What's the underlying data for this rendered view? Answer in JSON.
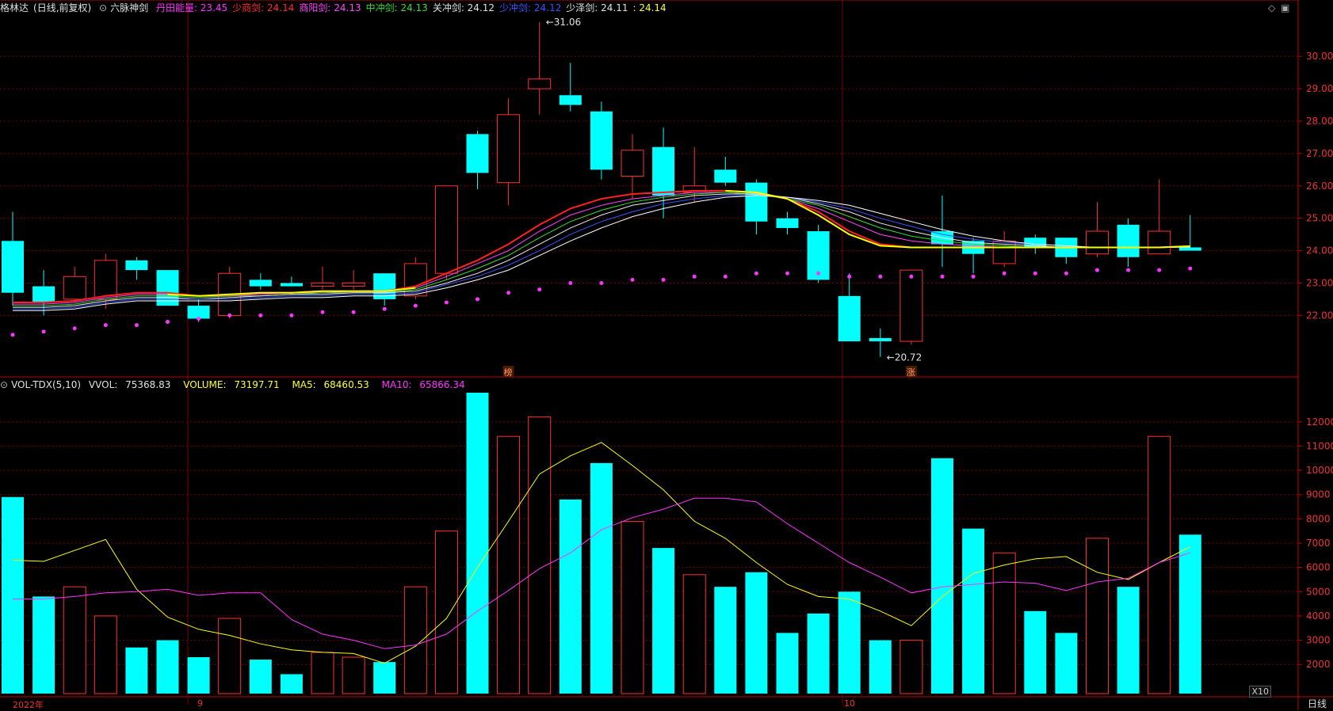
{
  "header": {
    "stock_name": "格林达",
    "mode": "(日线,前复权)",
    "indicator_name": "六脉神剑",
    "lines": [
      {
        "label": "丹田能量:",
        "value": "23.45",
        "color": "#ff33ff"
      },
      {
        "label": "少商剑:",
        "value": "24.14",
        "color": "#ff2a2a"
      },
      {
        "label": "商阳剑:",
        "value": "24.13",
        "color": "#ff44ff"
      },
      {
        "label": "中冲剑:",
        "value": "24.13",
        "color": "#33dd33"
      },
      {
        "label": "关冲剑:",
        "value": "24.12",
        "color": "#e0e0e0"
      },
      {
        "label": "少冲剑:",
        "value": "24.12",
        "color": "#3355ff"
      },
      {
        "label": "少泽剑:",
        "value": "24.11",
        "color": "#e0e0e0"
      },
      {
        "label": ":",
        "value": "24.14",
        "color": "#ffff33"
      }
    ]
  },
  "volume_header": {
    "name": "VOL-TDX(5,10)",
    "vvol_label": "VVOL:",
    "vvol": "75368.83",
    "volume_label": "VOLUME:",
    "volume": "73197.71",
    "ma5_label": "MA5:",
    "ma5": "68460.53",
    "ma10_label": "MA10:",
    "ma10": "65866.34",
    "colors": {
      "vvol": "#e0e0e0",
      "volume": "#ffff33",
      "ma5": "#ffff33",
      "ma10": "#ff33ff"
    }
  },
  "x_axis_labels": {
    "year": "2022年",
    "month_9": "9",
    "month_10": "10"
  },
  "period_label": "日线",
  "scale_label": "X10",
  "colors": {
    "up": "#ff3030",
    "down": "#00ffff",
    "grid": "#7a0000",
    "axis": "#c00000",
    "ma_red": "#ff2020",
    "ma_yellow": "#ffff00",
    "dots": "#ff33ff"
  },
  "chart_data": [
    {
      "type": "candlestick",
      "title": "六脉神剑",
      "ylim": [
        20.2,
        31.3
      ],
      "y_ticks": [
        "22.00",
        "23.00",
        "24.00",
        "25.00",
        "26.00",
        "27.00",
        "28.00",
        "29.00",
        "30.00"
      ],
      "annotations": [
        {
          "text": "31.06",
          "candle": 17,
          "value": 31.06
        },
        {
          "text": "20.72",
          "candle": 28,
          "value": 20.72
        }
      ],
      "markers": [
        {
          "text": "榜",
          "candle": 16
        },
        {
          "text": "涨",
          "candle": 29
        }
      ],
      "candles": [
        {
          "o": 24.3,
          "h": 25.2,
          "l": 22.3,
          "c": 22.7
        },
        {
          "o": 22.9,
          "h": 23.4,
          "l": 22.0,
          "c": 22.4
        },
        {
          "o": 22.5,
          "h": 23.5,
          "l": 22.4,
          "c": 23.2
        },
        {
          "o": 22.5,
          "h": 23.9,
          "l": 22.2,
          "c": 23.7
        },
        {
          "o": 23.7,
          "h": 23.8,
          "l": 23.1,
          "c": 23.4
        },
        {
          "o": 23.4,
          "h": 23.4,
          "l": 22.3,
          "c": 22.3
        },
        {
          "o": 22.3,
          "h": 22.5,
          "l": 21.8,
          "c": 21.9
        },
        {
          "o": 22.0,
          "h": 23.5,
          "l": 21.9,
          "c": 23.3
        },
        {
          "o": 23.1,
          "h": 23.3,
          "l": 22.8,
          "c": 22.9
        },
        {
          "o": 23.0,
          "h": 23.2,
          "l": 22.9,
          "c": 22.9
        },
        {
          "o": 22.9,
          "h": 23.5,
          "l": 22.8,
          "c": 23.0
        },
        {
          "o": 22.9,
          "h": 23.4,
          "l": 22.8,
          "c": 23.0
        },
        {
          "o": 23.3,
          "h": 23.3,
          "l": 22.3,
          "c": 22.5
        },
        {
          "o": 22.6,
          "h": 23.8,
          "l": 22.5,
          "c": 23.6
        },
        {
          "o": 23.3,
          "h": 26.0,
          "l": 23.1,
          "c": 26.0
        },
        {
          "o": 27.6,
          "h": 27.7,
          "l": 25.9,
          "c": 26.4
        },
        {
          "o": 26.1,
          "h": 28.7,
          "l": 25.4,
          "c": 28.2
        },
        {
          "o": 29.0,
          "h": 31.06,
          "l": 28.2,
          "c": 29.3
        },
        {
          "o": 28.8,
          "h": 29.8,
          "l": 28.3,
          "c": 28.5
        },
        {
          "o": 28.3,
          "h": 28.6,
          "l": 26.2,
          "c": 26.5
        },
        {
          "o": 26.3,
          "h": 27.6,
          "l": 25.6,
          "c": 27.1
        },
        {
          "o": 27.2,
          "h": 27.8,
          "l": 25.0,
          "c": 25.7
        },
        {
          "o": 25.8,
          "h": 27.2,
          "l": 25.5,
          "c": 26.0
        },
        {
          "o": 26.5,
          "h": 26.9,
          "l": 26.0,
          "c": 26.1
        },
        {
          "o": 26.1,
          "h": 26.2,
          "l": 24.5,
          "c": 24.9
        },
        {
          "o": 25.0,
          "h": 25.2,
          "l": 24.5,
          "c": 24.7
        },
        {
          "o": 24.6,
          "h": 24.8,
          "l": 23.0,
          "c": 23.1
        },
        {
          "o": 22.6,
          "h": 23.3,
          "l": 21.2,
          "c": 21.2
        },
        {
          "o": 21.3,
          "h": 21.6,
          "l": 20.72,
          "c": 21.2
        },
        {
          "o": 21.2,
          "h": 23.4,
          "l": 21.1,
          "c": 23.4
        },
        {
          "o": 24.6,
          "h": 25.7,
          "l": 23.5,
          "c": 24.2
        },
        {
          "o": 24.3,
          "h": 24.4,
          "l": 23.3,
          "c": 23.9
        },
        {
          "o": 23.6,
          "h": 24.6,
          "l": 23.5,
          "c": 24.3
        },
        {
          "o": 24.4,
          "h": 24.5,
          "l": 23.9,
          "c": 24.1
        },
        {
          "o": 24.4,
          "h": 24.4,
          "l": 23.6,
          "c": 23.8
        },
        {
          "o": 23.9,
          "h": 25.5,
          "l": 23.8,
          "c": 24.6
        },
        {
          "o": 24.8,
          "h": 25.0,
          "l": 23.5,
          "c": 23.8
        },
        {
          "o": 23.9,
          "h": 26.2,
          "l": 23.9,
          "c": 24.6
        },
        {
          "o": 24.1,
          "h": 25.1,
          "l": 24.0,
          "c": 24.0
        }
      ],
      "series": [
        {
          "name": "丹田能量",
          "style": "dots",
          "values": [
            21.4,
            21.5,
            21.6,
            21.7,
            21.7,
            21.8,
            21.9,
            22.0,
            22.0,
            22.0,
            22.1,
            22.1,
            22.2,
            22.3,
            22.4,
            22.5,
            22.7,
            22.8,
            23.0,
            23.0,
            23.1,
            23.1,
            23.2,
            23.2,
            23.3,
            23.3,
            23.3,
            23.2,
            23.2,
            23.2,
            23.2,
            23.2,
            23.3,
            23.3,
            23.3,
            23.4,
            23.4,
            23.4,
            23.45
          ]
        },
        {
          "name": "少商剑",
          "values": [
            22.4,
            22.4,
            22.45,
            22.6,
            22.7,
            22.7,
            22.6,
            22.6,
            22.7,
            22.7,
            22.75,
            22.75,
            22.75,
            22.9,
            23.3,
            23.7,
            24.2,
            24.8,
            25.3,
            25.6,
            25.75,
            25.8,
            25.85,
            25.85,
            25.8,
            25.6,
            25.2,
            24.6,
            24.2,
            24.1,
            24.1,
            24.1,
            24.1,
            24.1,
            24.1,
            24.1,
            24.1,
            24.1,
            24.14
          ]
        },
        {
          "name": "商阳剑",
          "values": [
            22.35,
            22.35,
            22.4,
            22.55,
            22.65,
            22.65,
            22.6,
            22.6,
            22.65,
            22.7,
            22.7,
            22.75,
            22.75,
            22.85,
            23.2,
            23.6,
            24.0,
            24.6,
            25.1,
            25.4,
            25.6,
            25.7,
            25.8,
            25.8,
            25.75,
            25.6,
            25.3,
            24.9,
            24.5,
            24.3,
            24.2,
            24.15,
            24.1,
            24.1,
            24.1,
            24.1,
            24.1,
            24.1,
            24.13
          ]
        },
        {
          "name": "中冲剑",
          "values": [
            22.3,
            22.3,
            22.35,
            22.5,
            22.6,
            22.6,
            22.55,
            22.6,
            22.6,
            22.65,
            22.7,
            22.7,
            22.7,
            22.8,
            23.1,
            23.45,
            23.85,
            24.4,
            24.9,
            25.25,
            25.5,
            25.65,
            25.75,
            25.8,
            25.75,
            25.6,
            25.4,
            25.05,
            24.7,
            24.45,
            24.3,
            24.2,
            24.15,
            24.1,
            24.1,
            24.1,
            24.1,
            24.1,
            24.13
          ]
        },
        {
          "name": "关冲剑",
          "values": [
            22.25,
            22.25,
            22.3,
            22.45,
            22.55,
            22.55,
            22.5,
            22.55,
            22.6,
            22.65,
            22.65,
            22.7,
            22.7,
            22.75,
            23.0,
            23.3,
            23.7,
            24.2,
            24.7,
            25.1,
            25.4,
            25.55,
            25.7,
            25.75,
            25.75,
            25.65,
            25.45,
            25.2,
            24.85,
            24.6,
            24.4,
            24.25,
            24.2,
            24.15,
            24.1,
            24.1,
            24.1,
            24.1,
            24.12
          ]
        },
        {
          "name": "少冲剑",
          "values": [
            22.2,
            22.2,
            22.25,
            22.4,
            22.5,
            22.5,
            22.5,
            22.5,
            22.55,
            22.6,
            22.6,
            22.65,
            22.65,
            22.7,
            22.95,
            23.2,
            23.55,
            24.0,
            24.5,
            24.9,
            25.2,
            25.45,
            25.6,
            25.7,
            25.7,
            25.65,
            25.5,
            25.3,
            25.0,
            24.75,
            24.5,
            24.35,
            24.25,
            24.2,
            24.15,
            24.1,
            24.1,
            24.1,
            24.12
          ]
        },
        {
          "name": "少泽剑",
          "values": [
            22.15,
            22.15,
            22.2,
            22.35,
            22.45,
            22.45,
            22.45,
            22.45,
            22.5,
            22.55,
            22.55,
            22.6,
            22.6,
            22.65,
            22.85,
            23.1,
            23.4,
            23.85,
            24.3,
            24.7,
            25.05,
            25.3,
            25.5,
            25.65,
            25.7,
            25.65,
            25.55,
            25.4,
            25.15,
            24.9,
            24.65,
            24.45,
            24.3,
            24.2,
            24.15,
            24.1,
            24.1,
            24.1,
            24.11
          ]
        },
        {
          "name": "",
          "color": "yellow",
          "values": [
            null,
            null,
            null,
            null,
            null,
            22.65,
            22.6,
            22.65,
            22.7,
            22.7,
            22.75,
            22.75,
            22.75,
            22.85,
            null,
            null,
            null,
            null,
            null,
            null,
            null,
            null,
            null,
            25.85,
            25.8,
            25.6,
            25.1,
            24.5,
            24.15,
            24.1,
            24.1,
            24.1,
            24.1,
            24.1,
            24.1,
            24.1,
            24.1,
            24.1,
            24.14
          ]
        }
      ]
    },
    {
      "type": "bar",
      "title": "VOL-TDX(5,10)",
      "ylim": [
        800,
        13200
      ],
      "y_ticks": [
        "2000",
        "3000",
        "4000",
        "5000",
        "6000",
        "7000",
        "8000",
        "9000",
        "10000",
        "11000",
        "12000"
      ],
      "values": [
        8900,
        4800,
        5200,
        4000,
        2700,
        3000,
        2300,
        3900,
        2200,
        1600,
        2500,
        2300,
        2100,
        5200,
        7500,
        13200,
        11400,
        12200,
        8800,
        10300,
        7900,
        6800,
        5700,
        5200,
        5800,
        3300,
        4100,
        5000,
        3000,
        3000,
        10500,
        7600,
        6600,
        4200,
        3300,
        7200,
        5200,
        11400,
        7350
      ],
      "series": [
        {
          "name": "MA5",
          "values": [
            6300,
            6250,
            6700,
            7150,
            5100,
            3950,
            3450,
            3200,
            2850,
            2600,
            2500,
            2450,
            2050,
            2750,
            3900,
            6000,
            7900,
            9850,
            10600,
            11150,
            10200,
            9200,
            7900,
            7200,
            6200,
            5300,
            4800,
            4700,
            4200,
            3600,
            4800,
            5750,
            6100,
            6350,
            6450,
            5800,
            5500,
            6200,
            6850
          ]
        },
        {
          "name": "MA10",
          "values": [
            4700,
            4700,
            4800,
            4950,
            5000,
            5100,
            4850,
            4950,
            4950,
            3850,
            3250,
            3000,
            2650,
            2800,
            3250,
            4200,
            5050,
            5950,
            6600,
            7550,
            8050,
            8400,
            8850,
            8850,
            8700,
            7800,
            7000,
            6200,
            5600,
            4950,
            5200,
            5300,
            5400,
            5350,
            5050,
            5400,
            5550,
            6200,
            6600
          ]
        }
      ]
    }
  ]
}
